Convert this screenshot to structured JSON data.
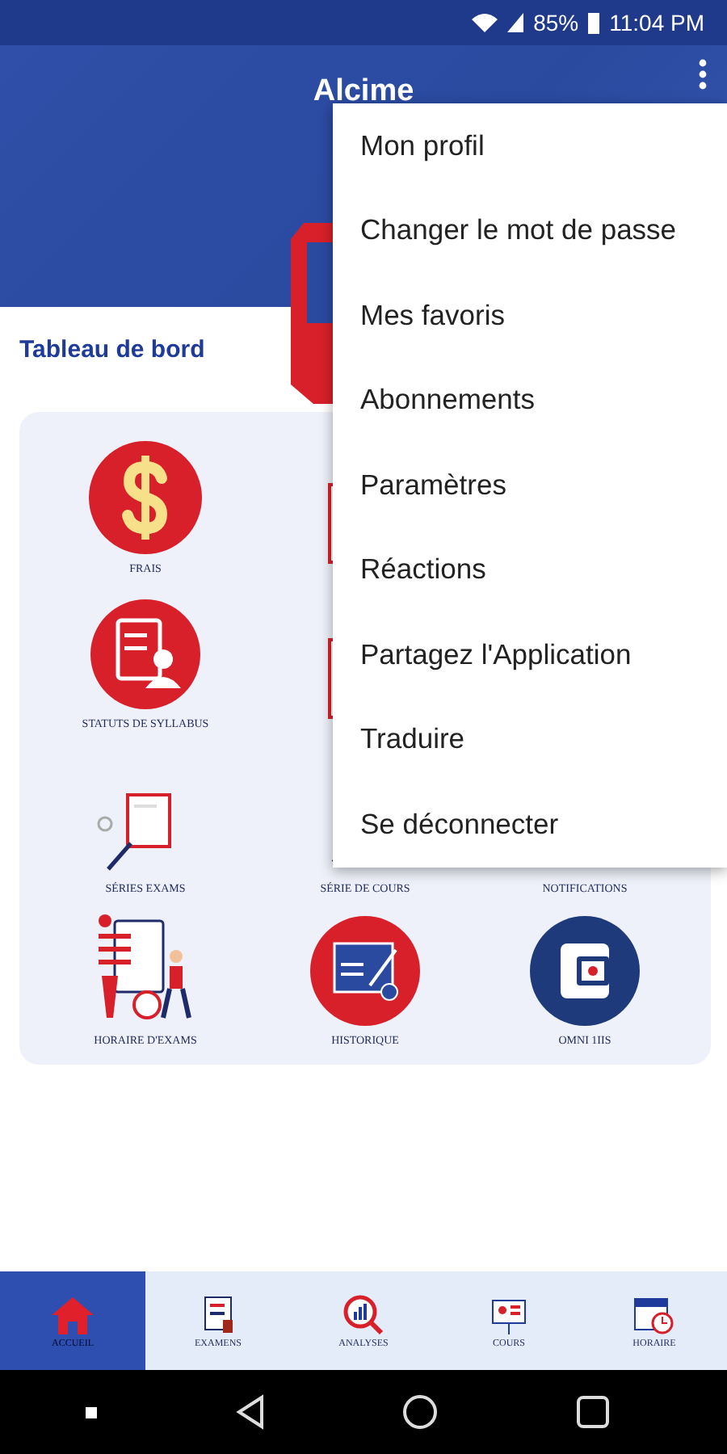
{
  "status_bar": {
    "battery": "85%",
    "time": "11:04 PM"
  },
  "header": {
    "title": "Alcime"
  },
  "section_title": "Tableau de bord",
  "tiles": [
    {
      "kind": "dollar",
      "label": "FRAIS"
    },
    {
      "kind": "figure"
    },
    {
      "kind": "blank"
    },
    {
      "kind": "syllabus",
      "label": "STATUTS DE SYLLABUS"
    },
    {
      "kind": "figure"
    },
    {
      "kind": "blank"
    },
    {
      "kind": "clipboard",
      "label": "SÉRIES EXAMS"
    },
    {
      "kind": "arrow",
      "label": "SÉRIE DE COURS"
    },
    {
      "kind": "blank",
      "label": "NOTIFICATIONS"
    },
    {
      "kind": "schedule",
      "label": "HORAIRE D'EXAMS"
    },
    {
      "kind": "exam",
      "label": "HISTORIQUE"
    },
    {
      "kind": "wallet",
      "label": "OMNI 1IIS"
    }
  ],
  "menu": [
    "Mon profil",
    "Changer le mot de passe",
    "Mes favoris",
    "Abonnements",
    "Paramètres",
    "Réactions",
    "Partagez l'Application",
    "Traduire",
    "Se déconnecter"
  ],
  "bottom_nav": [
    {
      "kind": "home",
      "label": "ACCUEIL",
      "selected": true
    },
    {
      "kind": "exams",
      "label": "EXAMENS",
      "selected": false
    },
    {
      "kind": "analysis",
      "label": "ANALYSES",
      "selected": false
    },
    {
      "kind": "courses",
      "label": "COURS",
      "selected": false
    },
    {
      "kind": "calendar",
      "label": "HORAIRE",
      "selected": false
    }
  ]
}
